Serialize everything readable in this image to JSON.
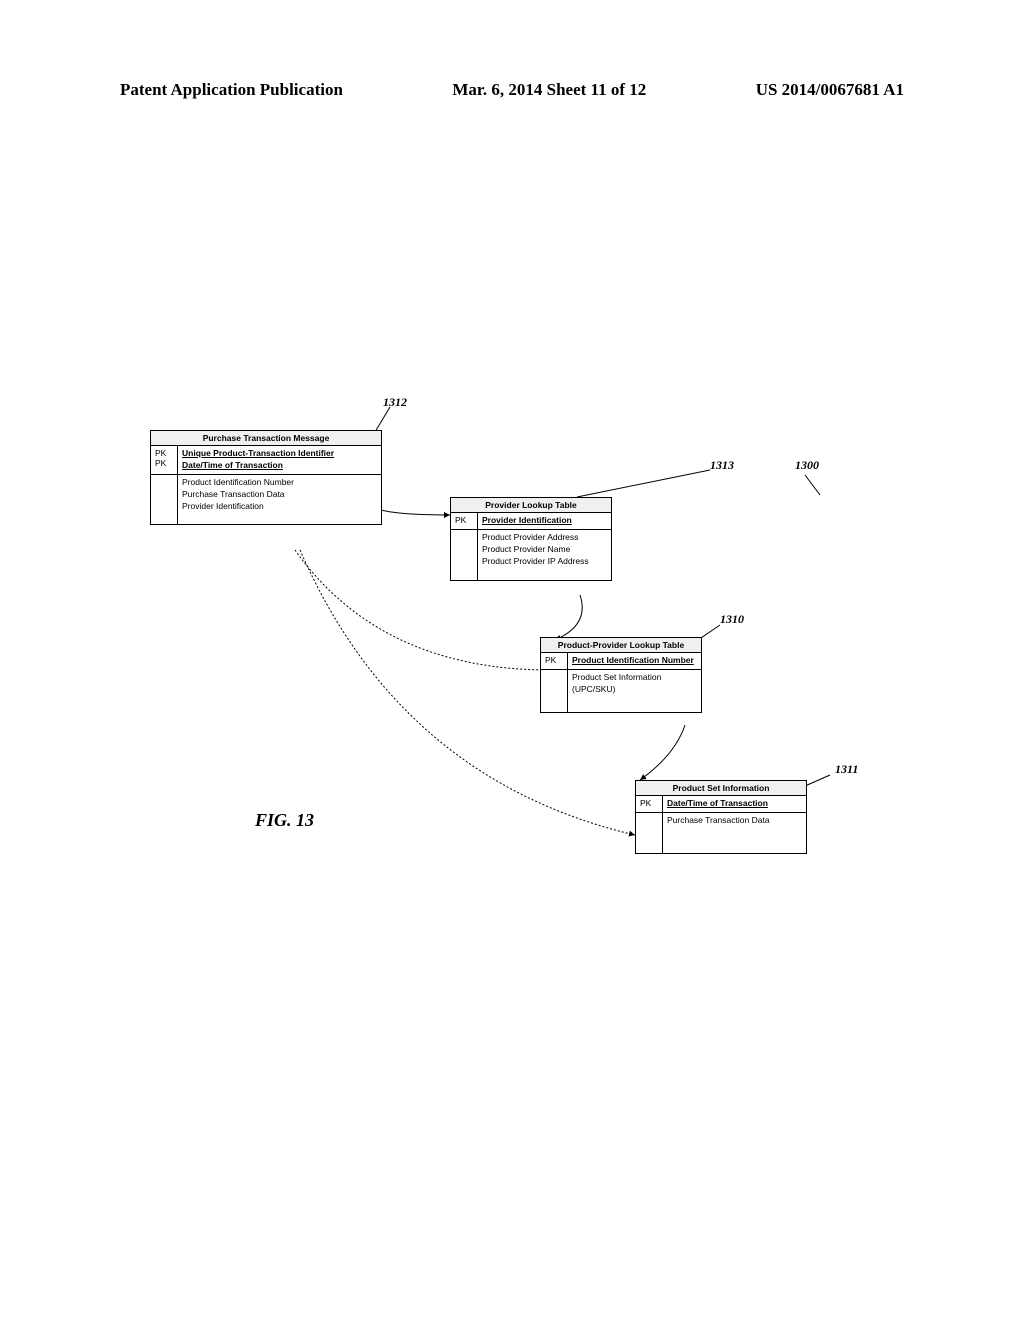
{
  "header": {
    "left": "Patent Application Publication",
    "center": "Mar. 6, 2014  Sheet 11 of 12",
    "right": "US 2014/0067681 A1"
  },
  "figure_label": "FIG. 13",
  "refs": {
    "r1312": "1312",
    "r1313": "1313",
    "r1300": "1300",
    "r1310": "1310",
    "r1311": "1311"
  },
  "entities": {
    "ptm": {
      "title": "Purchase Transaction Message",
      "pk": "PK\nPK",
      "keys": [
        "Unique Product-Transaction Identifier",
        "Date/Time of Transaction"
      ],
      "attrs": [
        "Product Identification Number",
        "Purchase Transaction Data",
        "Provider Identification"
      ]
    },
    "plt": {
      "title": "Provider Lookup Table",
      "pk": "PK",
      "keys": [
        "Provider Identification"
      ],
      "attrs": [
        "Product Provider Address",
        "Product Provider Name",
        "Product Provider IP Address"
      ]
    },
    "pplt": {
      "title": "Product-Provider Lookup Table",
      "pk": "PK",
      "keys": [
        "Product Identification Number"
      ],
      "attrs": [
        "Product Set Information (UPC/SKU)"
      ]
    },
    "psi": {
      "title": "Product Set Information",
      "pk": "PK",
      "keys": [
        "Date/Time of Transaction"
      ],
      "attrs": [
        "Purchase Transaction Data"
      ]
    }
  }
}
